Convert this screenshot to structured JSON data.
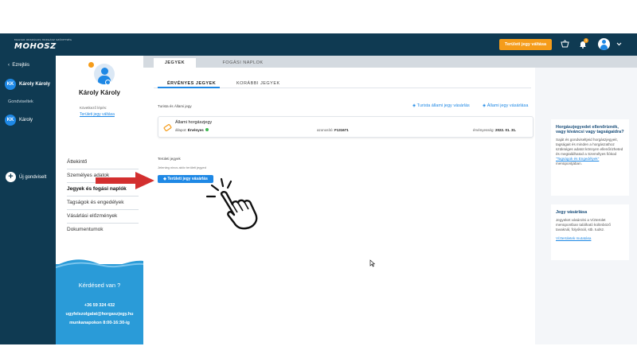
{
  "header": {
    "logo_tagline": "MAGYAR ORSZÁGOS HORGÁSZ SZÖVETSÉG",
    "logo": "MOHOSZ",
    "cta_button": "Területi jegy váltása",
    "notification_count": "3"
  },
  "left_nav": {
    "back_label": "Ezrejtés",
    "user": {
      "initials": "KK",
      "name": "Károly Károly"
    },
    "section_label": "Gondviseltek",
    "dependent": {
      "initials": "KK",
      "name": "Károly"
    },
    "add_dependent": "Új gondviselt"
  },
  "profile": {
    "name": "Károly Károly",
    "next_step_label": "Következő lépés:",
    "next_step_link": "Területi jegy váltása",
    "menu": [
      "Áttekintő",
      "Személyes adatok",
      "Jegyek és fogási naplók",
      "Tagságok és engedélyek",
      "Vásárlási előzmények",
      "Dokumentumok"
    ],
    "help": {
      "question": "Kérdésed van ?",
      "phone": "+36 59 324 432",
      "email": "ugyfelszolgalat@horgaszjegy.hu",
      "hours": "munkanapokon 8:00-16:30-ig"
    }
  },
  "tabs": [
    "JEGYEK",
    "FOGÁSI NAPLOK"
  ],
  "subtabs": [
    "ÉRVÉNYES JEGYEK",
    "KORÁBBI JEGYEK"
  ],
  "tourist_section": {
    "label": "Turista és Állami jegy",
    "link_tourist": "Turista állami jegy vásárlás",
    "link_state": "Állami jegy vásárlása"
  },
  "ticket": {
    "title": "Állami horgászjegy",
    "status_label": "állapot:",
    "status_value": "Érvényes",
    "id_label": "azonosító:",
    "id_value": "F131671",
    "valid_label": "érvényesség:",
    "valid_value": "2022. 01. 31."
  },
  "regional_section": {
    "label": "Területi jegyek",
    "empty_text": "Jelenleg nincs aktív területi jegyed",
    "button": "Területi jegy vásárlás"
  },
  "right_panel": {
    "card1": {
      "title": "Horgászjegyedet ellenőriznék, vagy kíváncsi vagy tagságaidra?",
      "text": "Saját és gondviseltjeid horgászjegyeit, tagságait és minden a horgászathoz szükséges adatot könnyen ellenőrizheted és megtalálhatod a Személyes fiókod",
      "link": "\"Tagságok és Engedélyek\"",
      "text_end": "menüpontjában."
    },
    "card2": {
      "title": "Jegy vásárlása",
      "text": "Jegyeket vásárolni a Vízterület menüpontban található különböző tavaknál, folyóknál, stb. tudsz.",
      "link": "Vízterületek mutatása"
    }
  },
  "colors": {
    "navy": "#0f3a52",
    "accent": "#f59c1a",
    "blue": "#1e88e5",
    "help_bg": "#2a9bd8",
    "arrow": "#d32f2f"
  }
}
